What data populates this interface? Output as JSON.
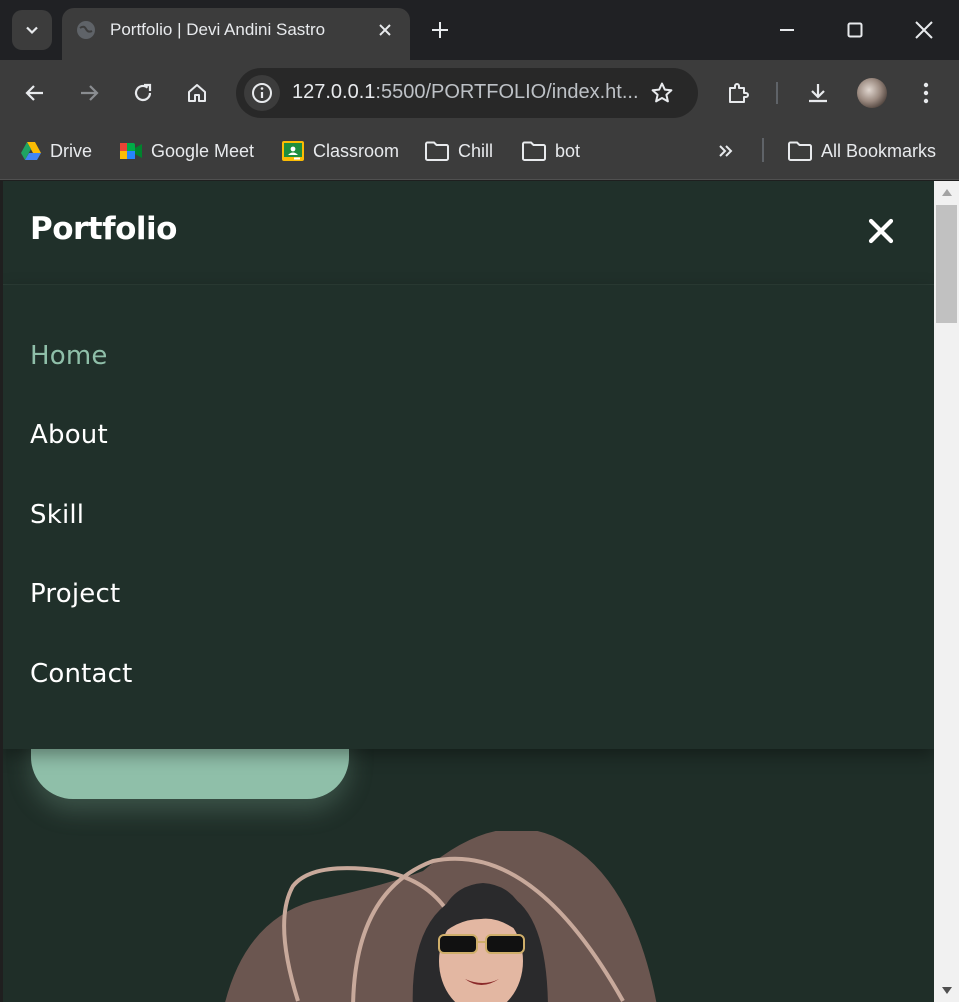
{
  "tab": {
    "title": "Portfolio | Devi Andini Sastro"
  },
  "omnibox": {
    "url_host": "127.0.0.1",
    "url_rest": ":5500/PORTFOLIO/index.ht..."
  },
  "bookmarks": [
    {
      "label": "Drive",
      "icon": "google-drive-icon"
    },
    {
      "label": "Google Meet",
      "icon": "google-meet-icon"
    },
    {
      "label": "Classroom",
      "icon": "google-classroom-icon"
    },
    {
      "label": "Chill",
      "icon": "folder-icon"
    },
    {
      "label": "bot",
      "icon": "folder-icon"
    }
  ],
  "all_bookmarks": "All Bookmarks",
  "site": {
    "logo": "Portfolio",
    "nav": [
      {
        "label": "Home",
        "active": true
      },
      {
        "label": "About",
        "active": false
      },
      {
        "label": "Skill",
        "active": false
      },
      {
        "label": "Project",
        "active": false
      },
      {
        "label": "Contact",
        "active": false
      }
    ]
  },
  "colors": {
    "page_bg": "#1f2e28",
    "header_bg": "#20302a",
    "accent": "#8fbfa9",
    "blob": "#6b5650"
  }
}
